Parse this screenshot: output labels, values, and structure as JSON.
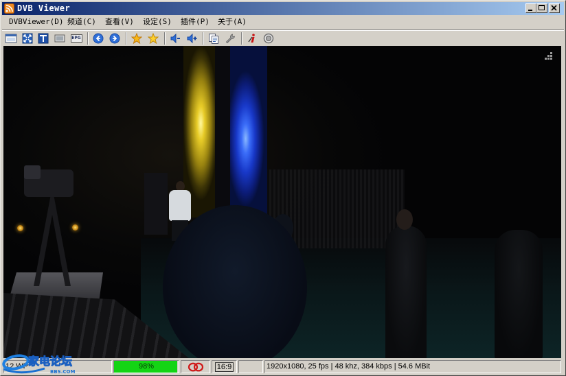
{
  "window": {
    "title": "DVB Viewer",
    "app_icon": "dvbviewer-app-icon",
    "controls": {
      "minimize": "minimize-icon",
      "maximize": "maximize-icon",
      "close": "close-icon"
    }
  },
  "menu": {
    "items": [
      {
        "label": "DVBViewer(D)"
      },
      {
        "label": "频道(C)"
      },
      {
        "label": "查看(V)"
      },
      {
        "label": "设定(S)"
      },
      {
        "label": "插件(P)"
      },
      {
        "label": "关于(A)"
      }
    ]
  },
  "toolbar": {
    "buttons": [
      {
        "icon": "display-window-icon"
      },
      {
        "icon": "fullscreen-icon"
      },
      {
        "icon": "teletext-icon"
      },
      {
        "icon": "snapshot-icon"
      },
      {
        "icon": "epg-icon",
        "label": "EPG"
      },
      {
        "icon": "previous-channel-icon"
      },
      {
        "icon": "next-channel-icon"
      },
      {
        "icon": "favorites-star-icon"
      },
      {
        "icon": "add-favorite-star-icon"
      },
      {
        "icon": "volume-down-icon"
      },
      {
        "icon": "volume-up-icon"
      },
      {
        "icon": "copy-icon"
      },
      {
        "icon": "settings-wrench-icon"
      },
      {
        "icon": "info-icon"
      },
      {
        "icon": "record-icon"
      }
    ]
  },
  "video": {
    "osd_icon": "osd-grid-icon"
  },
  "status": {
    "channel": "12 WP",
    "signal_text": "98%",
    "signal_level": 0.98,
    "audio_icon": "dolby-audio-icon",
    "aspect_ratio": "16:9",
    "stream_info": "1920x1080, 25 fps | 48 khz, 384 kbps | 54.6 MBit"
  },
  "watermark": {
    "logo_text": "家电论坛",
    "logo_subtext": "BBS.COM"
  },
  "colors": {
    "title_start": "#0a246a",
    "title_end": "#a6caf0",
    "signal_bar": "#14d414",
    "audio_icon": "#d01818"
  }
}
